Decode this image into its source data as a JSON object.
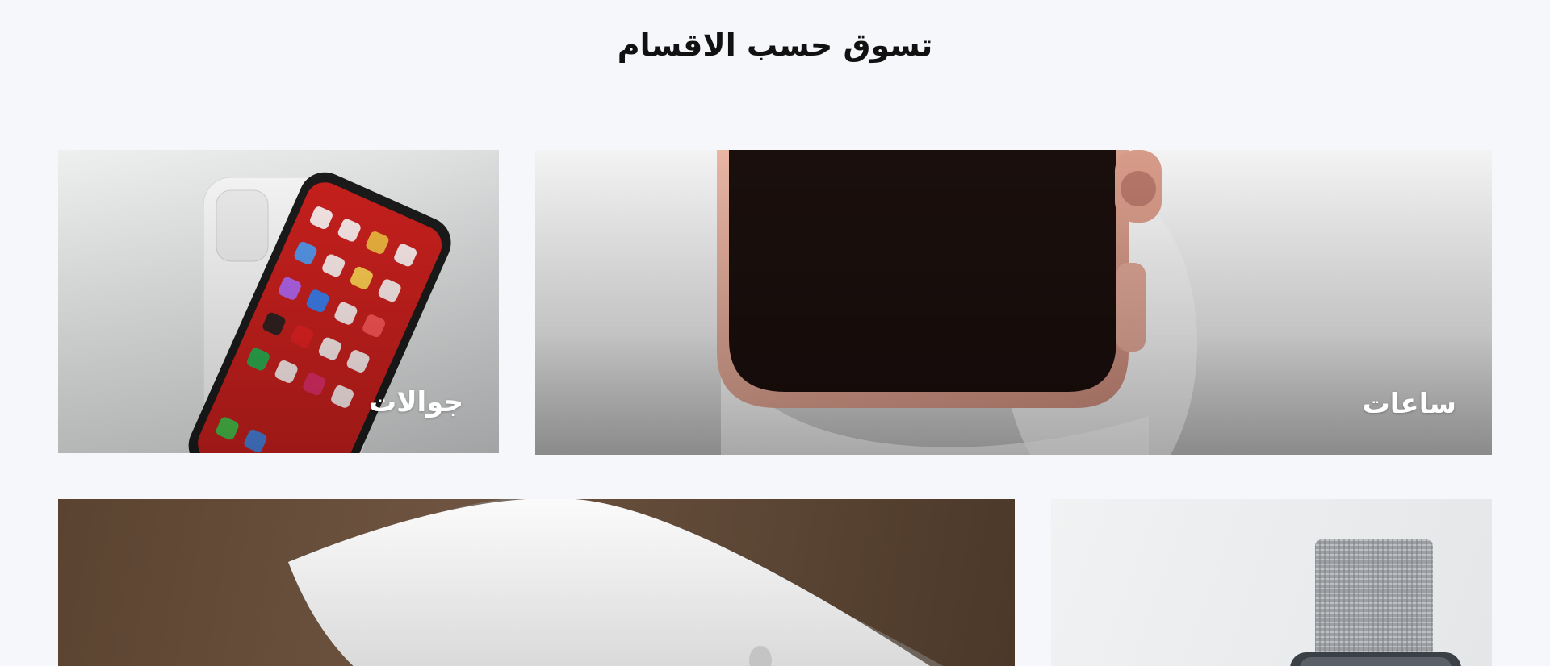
{
  "section": {
    "title": "تسوق حسب الاقسام"
  },
  "categories": [
    {
      "label": "ساعات",
      "image": "rose-gold-smartwatch-photo"
    },
    {
      "label": "جوالات",
      "image": "smartphone-in-white-case-photo"
    },
    {
      "label": "",
      "image": "watch-band-photo"
    },
    {
      "label": "",
      "image": "white-mouse-photo"
    }
  ]
}
